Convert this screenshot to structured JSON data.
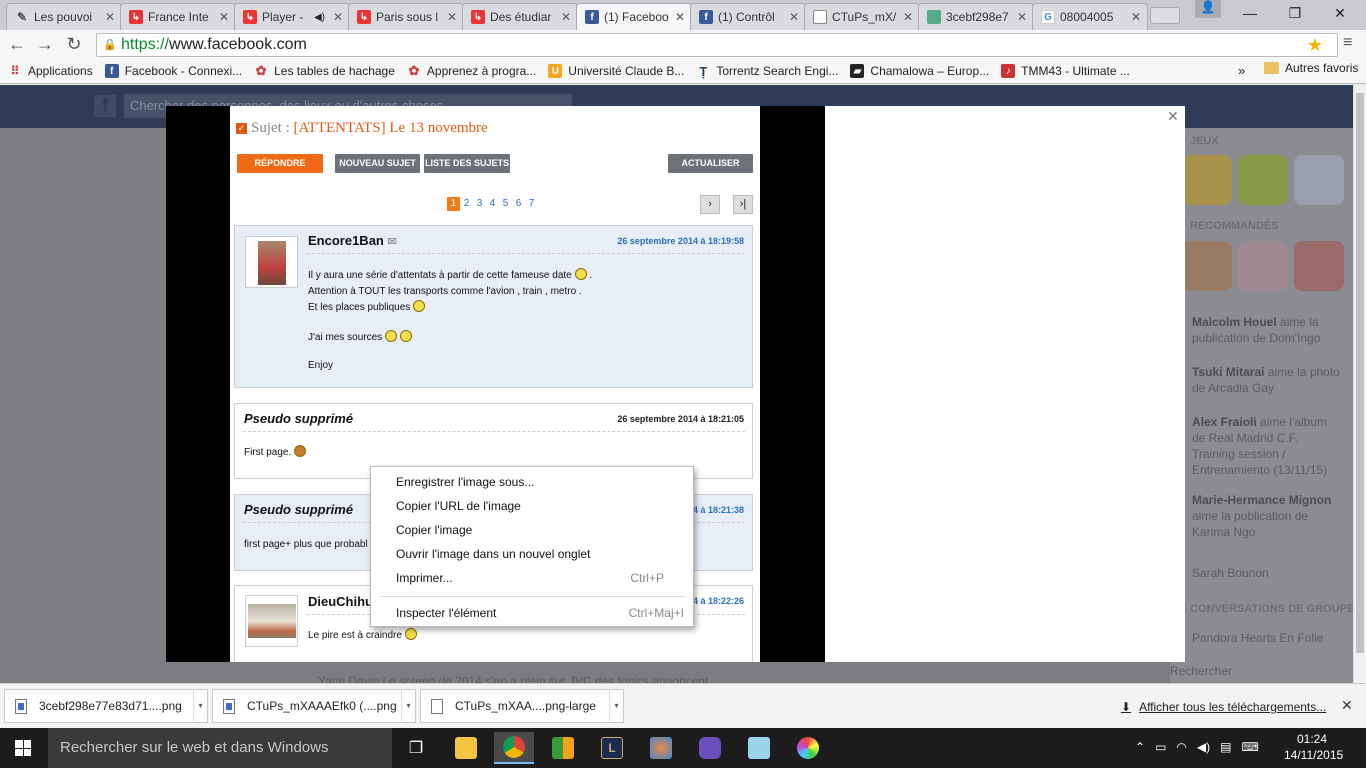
{
  "tabs": [
    {
      "title": "Les pouvoi",
      "icon": "feather-icon",
      "active": false
    },
    {
      "title": "France Inte",
      "icon": "red-site-icon",
      "active": false
    },
    {
      "title": "Player -",
      "icon": "red-site-icon",
      "active": false
    },
    {
      "title": "Paris sous l",
      "icon": "red-site-icon",
      "active": false
    },
    {
      "title": "Des étudiar",
      "icon": "red-site-icon",
      "active": false
    },
    {
      "title": "(1) Faceboo",
      "icon": "facebook-icon",
      "active": true
    },
    {
      "title": "(1) Contrôl",
      "icon": "facebook-icon",
      "active": false
    },
    {
      "title": "CTuPs_mX/",
      "icon": "document-icon",
      "active": false
    },
    {
      "title": "3cebf298e7",
      "icon": "image-icon",
      "active": false
    },
    {
      "title": "08004005",
      "icon": "google-icon",
      "active": false
    }
  ],
  "omnibox": {
    "scheme": "https://",
    "host": "www.facebook.com"
  },
  "bookmarks": [
    {
      "label": "Applications",
      "icon": "apps-grid-icon"
    },
    {
      "label": "Facebook - Connexi...",
      "icon": "facebook-icon"
    },
    {
      "label": "Les tables de hachage",
      "icon": "cookie-icon"
    },
    {
      "label": "Apprenez à progra...",
      "icon": "cookie-icon"
    },
    {
      "label": "Université Claude B...",
      "icon": "university-icon"
    },
    {
      "label": "Torrentz Search Engi...",
      "icon": "torrentz-icon"
    },
    {
      "label": "Chamalowa – Europ...",
      "icon": "chamalowa-icon"
    },
    {
      "label": "TMM43 - Ultimate ...",
      "icon": "music-note-icon"
    }
  ],
  "bookmarks_more": "»",
  "other_bookmarks": "Autres favoris",
  "facebook": {
    "search_placeholder": "Chercher des personnes, des lieux ou d'autres choses",
    "sidebar_sections": [
      "JEUX",
      "RECOMMANDÉS",
      "CONVERSATIONS DE GROUPE"
    ],
    "activity": [
      {
        "name": "Malcolm Houel",
        "rest": " aime la publication de Dom'Ingo"
      },
      {
        "name": "Tsuki Mitarai",
        "rest": " aime la photo de Arcadia Gay"
      },
      {
        "name": "Alex Fraioli",
        "rest": " aime l'album de Real Madrid C.F. Training session / Entrenamiento (13/11/15)"
      },
      {
        "name": "Marie-Hermance Mignon",
        "rest": " aime la publication de Karima Ngo"
      }
    ],
    "contact": "Sarah Bounon",
    "group": "Pandora Hearts En Folie",
    "search_chat": "Rechercher",
    "feed_text": "Yann Davin Le screen de 2014 s'en a plein sur JVC des topics annoncent"
  },
  "forum": {
    "subject_label": "Sujet :",
    "subject_title": "[ATTENTATS] Le 13 novembre",
    "btn_reply": "RÉPONDRE",
    "btn_new": "NOUVEAU SUJET",
    "btn_list": "LISTE DES SUJETS",
    "btn_refresh": "ACTUALISER",
    "pages": [
      "1",
      "2",
      "3",
      "4",
      "5",
      "6",
      "7"
    ],
    "current_page": "1",
    "posts": [
      {
        "author": "Encore1Ban",
        "date": "26 septembre 2014 à 18:19:58",
        "lines": [
          "Il y aura une série d'attentats à partir de cette fameuse date",
          "Attention à TOUT les transports comme l'avion , train , metro .",
          "Et les places publiques",
          "J'ai mes sources",
          "Enjoy"
        ]
      },
      {
        "author": "Pseudo supprimé",
        "date": "26 septembre 2014 à 18:21:05",
        "lines": [
          "First page."
        ]
      },
      {
        "author": "Pseudo supprimé",
        "date": "4 à 18:21:38",
        "lines": [
          "first page+ plus que probabl"
        ]
      },
      {
        "author": "DieuChihu",
        "date": "4 à 18:22:26",
        "lines": [
          "Le pire est à craindre"
        ]
      }
    ]
  },
  "context_menu": {
    "items": [
      {
        "label": "Enregistrer l'image sous...",
        "shortcut": ""
      },
      {
        "label": "Copier l'URL de l'image",
        "shortcut": ""
      },
      {
        "label": "Copier l'image",
        "shortcut": ""
      },
      {
        "label": "Ouvrir l'image dans un nouvel onglet",
        "shortcut": ""
      },
      {
        "label": "Imprimer...",
        "shortcut": "Ctrl+P"
      },
      {
        "label": "Inspecter l'élément",
        "shortcut": "Ctrl+Maj+I"
      }
    ]
  },
  "downloads": [
    {
      "name": "3cebf298e77e83d71....png"
    },
    {
      "name": "CTuPs_mXAAAEfk0 (....png"
    },
    {
      "name": "CTuPs_mXAA....png-large"
    }
  ],
  "show_all_downloads": "Afficher tous les téléchargements...",
  "taskbar": {
    "search_placeholder": "Rechercher sur le web et dans Windows",
    "time": "01:24",
    "date": "14/11/2015"
  },
  "colors": {
    "facebook_blue": "#3b5998",
    "forum_orange": "#f07d1a",
    "link_blue": "#2a6ec7"
  }
}
